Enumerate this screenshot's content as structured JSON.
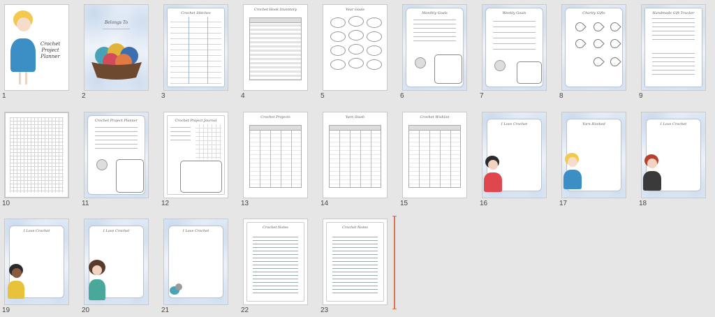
{
  "slides": [
    {
      "number": "1",
      "title": "Crochet Project Planner"
    },
    {
      "number": "2",
      "title": "Belongs To"
    },
    {
      "number": "3",
      "title": "Crochet Stitches"
    },
    {
      "number": "4",
      "title": "Crochet Hook Inventory"
    },
    {
      "number": "5",
      "title": "Year Goals"
    },
    {
      "number": "6",
      "title": "Monthly Goals"
    },
    {
      "number": "7",
      "title": "Weekly Goals"
    },
    {
      "number": "8",
      "title": "Charity Gifts"
    },
    {
      "number": "9",
      "title": "Handmade Gift Tracker"
    },
    {
      "number": "10",
      "title": ""
    },
    {
      "number": "11",
      "title": "Crochet Project Planner"
    },
    {
      "number": "12",
      "title": "Crochet Project Journal"
    },
    {
      "number": "13",
      "title": "Crochet Projects"
    },
    {
      "number": "14",
      "title": "Yarn Stash"
    },
    {
      "number": "15",
      "title": "Crochet Wishlist"
    },
    {
      "number": "16",
      "title": "I Love Crochet"
    },
    {
      "number": "17",
      "title": "Yarn Hooked"
    },
    {
      "number": "18",
      "title": "I Love Crochet"
    },
    {
      "number": "19",
      "title": "I Love Crochet"
    },
    {
      "number": "20",
      "title": "I Love Crochet"
    },
    {
      "number": "21",
      "title": "I Love Crochet"
    },
    {
      "number": "22",
      "title": "Crochet Notes"
    },
    {
      "number": "23",
      "title": "Crochet Notes"
    }
  ],
  "colors": {
    "background": "#e6e6e6",
    "insertion_marker": "#d9734f",
    "wash": "#aac3e1"
  }
}
